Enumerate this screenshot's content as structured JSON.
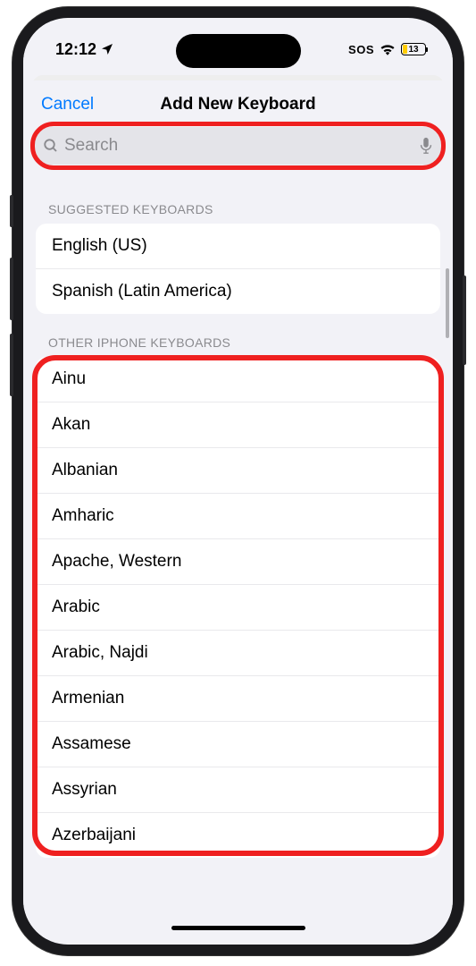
{
  "status": {
    "time": "12:12",
    "sos": "SOS",
    "battery": "13"
  },
  "sheet": {
    "cancel": "Cancel",
    "title": "Add New Keyboard"
  },
  "search": {
    "placeholder": "Search"
  },
  "sections": {
    "suggested_header": "SUGGESTED KEYBOARDS",
    "other_header": "OTHER IPHONE KEYBOARDS"
  },
  "suggested": [
    {
      "label": "English (US)"
    },
    {
      "label": "Spanish (Latin America)"
    }
  ],
  "other": [
    {
      "label": "Ainu"
    },
    {
      "label": "Akan"
    },
    {
      "label": "Albanian"
    },
    {
      "label": "Amharic"
    },
    {
      "label": "Apache, Western"
    },
    {
      "label": "Arabic"
    },
    {
      "label": "Arabic, Najdi"
    },
    {
      "label": "Armenian"
    },
    {
      "label": "Assamese"
    },
    {
      "label": "Assyrian"
    },
    {
      "label": "Azerbaijani"
    }
  ]
}
